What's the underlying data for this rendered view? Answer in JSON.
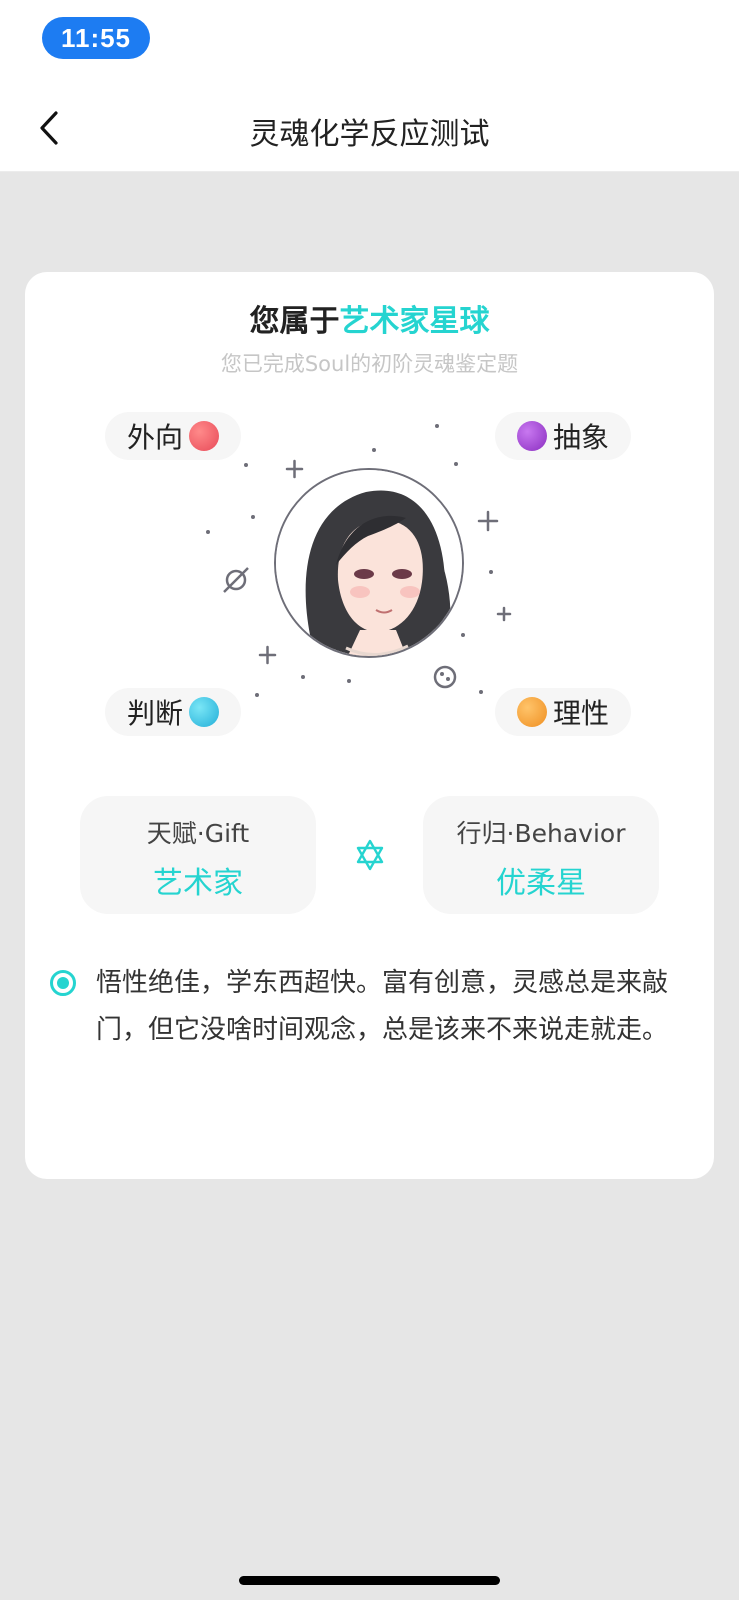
{
  "status_bar": {
    "time": "11:55"
  },
  "nav": {
    "title": "灵魂化学反应测试"
  },
  "card": {
    "heading_prefix": "您属于",
    "heading_planet": "艺术家星球",
    "subtitle": "您已完成Soul的初阶灵魂鉴定题",
    "traits": {
      "top_left": {
        "label": "外向",
        "color": "#f05a64"
      },
      "top_right": {
        "label": "抽象",
        "color": "#a040d0"
      },
      "bottom_left": {
        "label": "判断",
        "color": "#3cc8e8"
      },
      "bottom_right": {
        "label": "理性",
        "color": "#f5a032"
      }
    },
    "gift": {
      "label": "天赋·Gift",
      "value": "艺术家"
    },
    "behavior": {
      "label": "行归·Behavior",
      "value": "优柔星"
    },
    "description": "悟性绝佳，学东西超快。富有创意，灵感总是来敲门，但它没啥时间观念，总是该来不来说走就走。"
  },
  "colors": {
    "accent": "#25d4d0",
    "time_pill": "#1d7cf2"
  }
}
